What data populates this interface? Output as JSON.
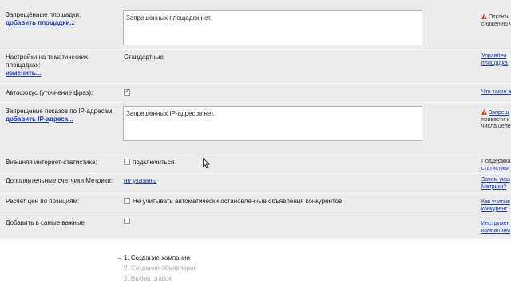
{
  "forbidden_sites": {
    "label": "Запрещённые площадки:",
    "link": "добавить площадки...",
    "value": "Запрещенных площадок нет.",
    "right_text_1": "Отключ",
    "right_text_2": "снижению ч"
  },
  "theme_settings": {
    "label": "Настройки на тематических площадках:",
    "link": "изменить...",
    "value": "Стандартные",
    "right_link_1": "Управлен",
    "right_link_2": "площадка"
  },
  "autofocus": {
    "label": "Автофокус (уточнение фраз):",
    "checked": true,
    "right_link": "Что такое а"
  },
  "ip_ban": {
    "label": "Запрещение показов по IP-адресам:",
    "link": "добавить IP-адреса...",
    "value": "Запрещенных IP-адресов нет.",
    "right_link": "Запрещ",
    "right_text_1": "привести к",
    "right_text_2": "числа целев"
  },
  "external_stats": {
    "label": "Внешняя интернет-статистика:",
    "checkbox_label": "подключиться",
    "right_text": "Поддержка",
    "right_link": "статистики"
  },
  "metrika_counters": {
    "label": "Дополнительные счетчики Метрики:",
    "value_link": "не указаны",
    "right_link_1": "Зачем указ",
    "right_link_2": "Метрики?"
  },
  "position_pricing": {
    "label": "Расчет цен по позициям:",
    "checkbox_label": "Не учитывать автоматически остановленные объявления конкурентов",
    "right_link_1": "Как учитыв",
    "right_link_2": "конкурент"
  },
  "important": {
    "label": "Добавить в самые важные",
    "right_link_1": "Инструмен",
    "right_link_2": "кампаниям"
  },
  "steps": [
    "1. Создание кампании",
    "2. Создание объявления",
    "3. Выбор ставок"
  ],
  "colors": {
    "form_bg": "#ececec",
    "link": "#1a3dbc",
    "warning": "#cc2200"
  },
  "icons": {
    "warning": "warning-triangle-icon",
    "step_arrow": "arrow-right-icon",
    "cursor": "mouse-cursor-icon"
  }
}
